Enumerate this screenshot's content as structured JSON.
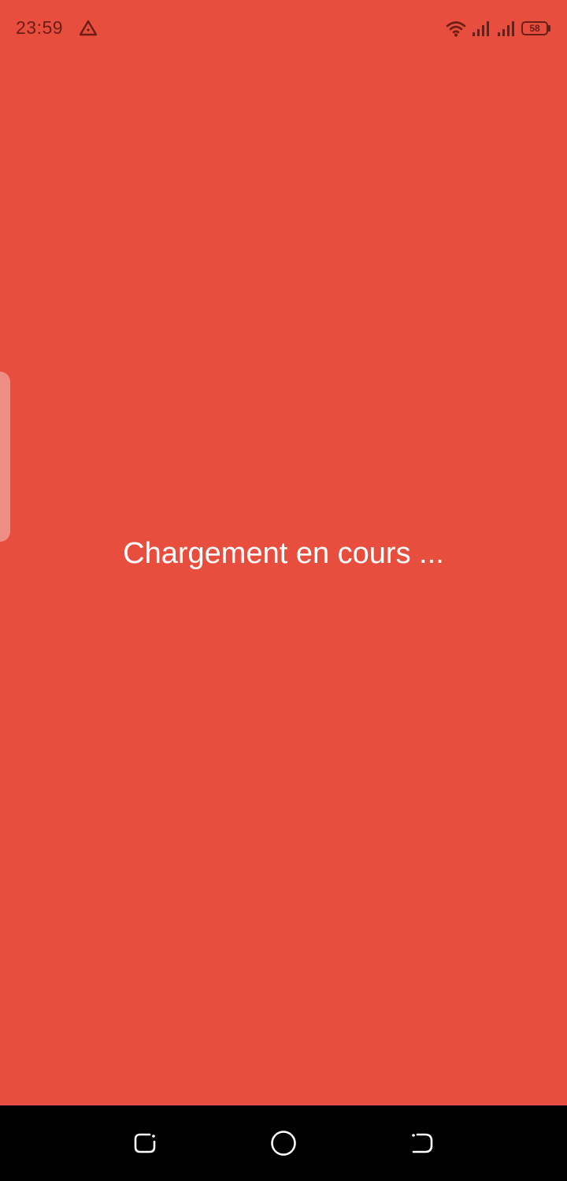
{
  "status_bar": {
    "time": "23:59",
    "battery_level": "58",
    "icons": {
      "notification": "warning-triangle-icon",
      "wifi": "wifi-icon",
      "signal_1": "cell-signal-icon",
      "signal_2": "cell-signal-icon",
      "battery": "battery-icon"
    }
  },
  "main": {
    "loading_text": "Chargement en cours ..."
  },
  "navigation_bar": {
    "icons": {
      "recents": "recents-icon",
      "home": "home-icon",
      "back": "back-icon"
    }
  },
  "colors": {
    "background": "#E84E3E",
    "status_text": "#6A1E16",
    "loading_text": "#FFFFFF",
    "side_handle": "#EE8E85",
    "nav_bar": "#000000"
  }
}
